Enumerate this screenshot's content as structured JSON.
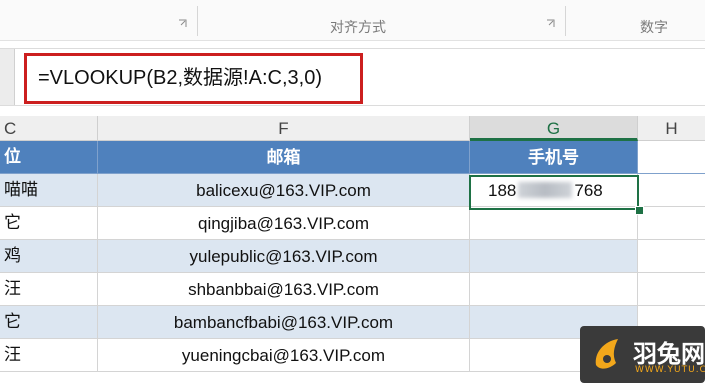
{
  "ribbon": {
    "groups": [
      "对齐方式",
      "数字"
    ]
  },
  "formula_bar": {
    "formula": "=VLOOKUP(B2,数据源!A:C,3,0)"
  },
  "columns": [
    "C",
    "F",
    "G",
    "H"
  ],
  "table": {
    "headers": [
      "位",
      "邮箱",
      "手机号"
    ],
    "rows": [
      {
        "c": "喵喵",
        "email": "balicexu@163.VIP.com",
        "phone_start": "188",
        "phone_end": "768"
      },
      {
        "c": "它",
        "email": "qingjiba@163.VIP.com"
      },
      {
        "c": "鸡",
        "email": "yulepublic@163.VIP.com"
      },
      {
        "c": "汪",
        "email": "shbanbbai@163.VIP.com"
      },
      {
        "c": "它",
        "email": "bambancfbabi@163.VIP.com"
      },
      {
        "c": "汪",
        "email": "yueningcbai@163.VIP.com"
      }
    ]
  },
  "watermark": {
    "title": "羽兔网",
    "url": "WWW.YUTU.CN",
    "accent": "#f2a71b"
  },
  "colors": {
    "header_fill": "#4f81bd",
    "band_fill": "#dce6f1",
    "selection": "#1e7145",
    "highlight_box": "#cc1f1f"
  }
}
